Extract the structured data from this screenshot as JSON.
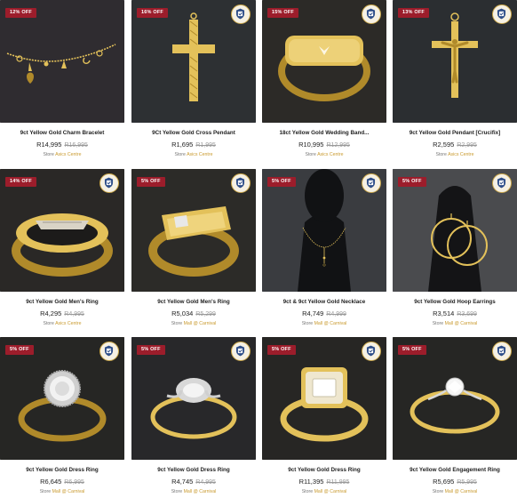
{
  "colors": {
    "badge": "#9c1d2b",
    "store_link": "#c99a2e",
    "image_bg": "#26292d"
  },
  "badge_icon": "quality-shield-icon",
  "products": [
    {
      "discount": "12% OFF",
      "title": "9ct Yellow Gold Charm Bracelet",
      "price": "R14,995",
      "old_price": "R16,995",
      "store_label": "Store",
      "store": "Asics Centre"
    },
    {
      "discount": "16% OFF",
      "title": "9Ct Yellow Gold Cross Pendant",
      "price": "R1,695",
      "old_price": "R1,995",
      "store_label": "Store",
      "store": "Asics Centre"
    },
    {
      "discount": "15% OFF",
      "title": "18ct Yellow Gold Wedding Band...",
      "price": "R10,995",
      "old_price": "R12,995",
      "store_label": "Store",
      "store": "Asics Centre"
    },
    {
      "discount": "13% OFF",
      "title": "9ct Yellow Gold Pendant [Crucifix]",
      "price": "R2,595",
      "old_price": "R2,995",
      "store_label": "Store",
      "store": "Asics Centre"
    },
    {
      "discount": "14% OFF",
      "title": "9ct Yellow Gold Men's Ring",
      "price": "R4,295",
      "old_price": "R4,995",
      "store_label": "Store",
      "store": "Asics Centre"
    },
    {
      "discount": "5% OFF",
      "title": "9ct Yellow Gold Men's Ring",
      "price": "R5,034",
      "old_price": "R5,299",
      "store_label": "Store",
      "store": "Mall @ Carnival"
    },
    {
      "discount": "5% OFF",
      "title": "9ct & 9ct Yellow Gold Necklace",
      "price": "R4,749",
      "old_price": "R4,999",
      "store_label": "Store",
      "store": "Mall @ Carnival"
    },
    {
      "discount": "5% OFF",
      "title": "9ct Yellow Gold Hoop Earrings",
      "price": "R3,514",
      "old_price": "R3,699",
      "store_label": "Store",
      "store": "Mall @ Carnival"
    },
    {
      "discount": "5% OFF",
      "title": "9ct Yellow Gold Dress Ring",
      "price": "R6,645",
      "old_price": "R6,995",
      "store_label": "Store",
      "store": "Mall @ Carnival"
    },
    {
      "discount": "5% OFF",
      "title": "9ct Yellow Gold Dress Ring",
      "price": "R4,745",
      "old_price": "R4,995",
      "store_label": "Store",
      "store": "Mall @ Carnival"
    },
    {
      "discount": "5% OFF",
      "title": "9ct Yellow Gold Dress Ring",
      "price": "R11,395",
      "old_price": "R11,995",
      "store_label": "Store",
      "store": "Mall @ Carnival"
    },
    {
      "discount": "5% OFF",
      "title": "9ct Yellow Gold Engagement Ring",
      "price": "R5,695",
      "old_price": "R5,995",
      "store_label": "Store",
      "store": "Mall @ Carnival"
    }
  ]
}
